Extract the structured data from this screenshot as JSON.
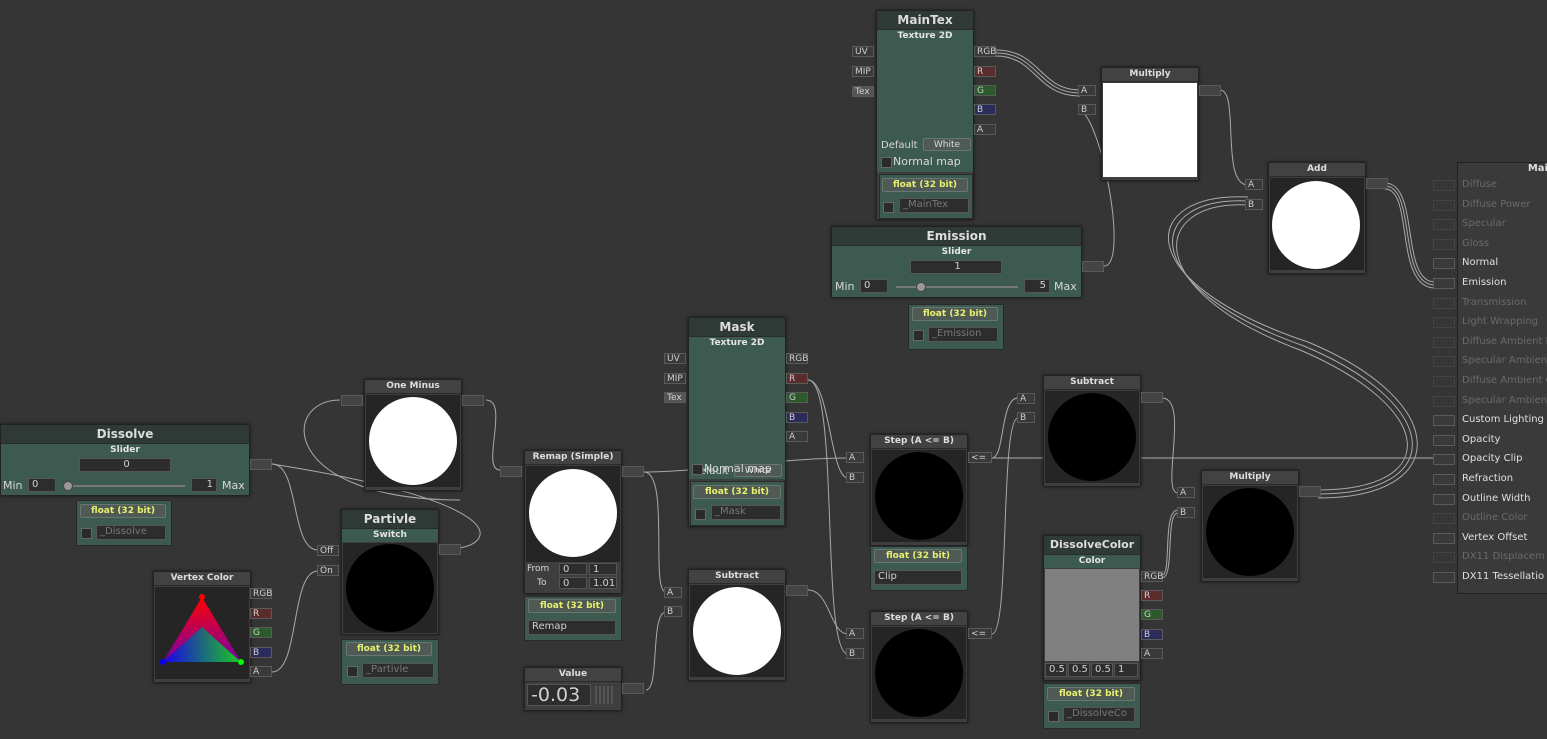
{
  "nodes": {
    "maintex": {
      "title": "MainTex",
      "subtitle": "Texture 2D",
      "inputs": [
        "UV",
        "MIP",
        "Tex"
      ],
      "outputs": [
        "RGB",
        "R",
        "G",
        "B",
        "A"
      ],
      "default_label": "Default",
      "default_value": "White",
      "normal_map": "Normal map",
      "precision": "float (32 bit)",
      "property": "_MainTex"
    },
    "multiply_top": {
      "title": "Multiply",
      "inputs": [
        "A",
        "B"
      ]
    },
    "add": {
      "title": "Add",
      "inputs": [
        "A",
        "B"
      ]
    },
    "emission": {
      "title": "Emission",
      "subtitle": "Slider",
      "value": "1",
      "min_label": "Min",
      "min": "0",
      "max": "5",
      "max_label": "Max",
      "precision": "float (32 bit)",
      "property": "_Emission"
    },
    "mask": {
      "title": "Mask",
      "subtitle": "Texture 2D",
      "inputs": [
        "UV",
        "MIP",
        "Tex"
      ],
      "outputs": [
        "RGB",
        "R",
        "G",
        "B",
        "A"
      ],
      "default_label": "Default",
      "default_value": "White",
      "normal_map": "Normal map",
      "precision": "float (32 bit)",
      "property": "_Mask"
    },
    "one_minus": {
      "title": "One Minus"
    },
    "dissolve": {
      "title": "Dissolve",
      "subtitle": "Slider",
      "value": "0",
      "min_label": "Min",
      "min": "0",
      "max": "1",
      "max_label": "Max",
      "precision": "float (32 bit)",
      "property": "_Dissolve"
    },
    "partivle": {
      "title": "Partivle",
      "subtitle": "Switch",
      "inputs": [
        "Off",
        "On"
      ],
      "precision": "float (32 bit)",
      "property": "_Partivle"
    },
    "vertex_color": {
      "title": "Vertex Color",
      "outputs": [
        "RGB",
        "R",
        "G",
        "B",
        "A"
      ]
    },
    "remap": {
      "title": "Remap (Simple)",
      "from_label": "From",
      "from_a": "0",
      "from_b": "1",
      "to_label": "To",
      "to_a": "0",
      "to_b": "1.01",
      "precision": "float (32 bit)",
      "name": "Remap"
    },
    "value": {
      "title": "Value",
      "value": "-0.03"
    },
    "subtract_bottom": {
      "title": "Subtract",
      "inputs": [
        "A",
        "B"
      ]
    },
    "step_top": {
      "title": "Step (A <= B)",
      "inputs": [
        "A",
        "B"
      ],
      "output": "<=",
      "precision": "float (32 bit)",
      "name": "Clip"
    },
    "step_bottom": {
      "title": "Step (A <= B)",
      "inputs": [
        "A",
        "B"
      ],
      "output": "<="
    },
    "subtract_top": {
      "title": "Subtract",
      "inputs": [
        "A",
        "B"
      ]
    },
    "multiply_bottom": {
      "title": "Multiply",
      "inputs": [
        "A",
        "B"
      ]
    },
    "dissolve_color": {
      "title": "DissolveColor",
      "subtitle": "Color",
      "values": [
        "0.5",
        "0.5",
        "0.5",
        "1"
      ],
      "outputs": [
        "RGB",
        "R",
        "G",
        "B",
        "A"
      ],
      "precision": "float (32 bit)",
      "property": "_DissolveCo"
    }
  },
  "main": {
    "title": "Mai",
    "items": [
      {
        "label": "Diffuse",
        "active": false
      },
      {
        "label": "Diffuse Power",
        "active": false
      },
      {
        "label": "Specular",
        "active": false
      },
      {
        "label": "Gloss",
        "active": false
      },
      {
        "label": "Normal",
        "active": true
      },
      {
        "label": "Emission",
        "active": true
      },
      {
        "label": "Transmission",
        "active": false
      },
      {
        "label": "Light Wrapping",
        "active": false
      },
      {
        "label": "Diffuse Ambient L",
        "active": false
      },
      {
        "label": "Specular Ambien",
        "active": false
      },
      {
        "label": "Diffuse Ambient O",
        "active": false
      },
      {
        "label": "Specular Ambien",
        "active": false
      },
      {
        "label": "Custom Lighting",
        "active": true
      },
      {
        "label": "Opacity",
        "active": true
      },
      {
        "label": "Opacity Clip",
        "active": true
      },
      {
        "label": "Refraction",
        "active": true
      },
      {
        "label": "Outline Width",
        "active": true
      },
      {
        "label": "Outline Color",
        "active": false
      },
      {
        "label": "Vertex Offset",
        "active": true
      },
      {
        "label": "DX11 Displacem",
        "active": false
      },
      {
        "label": "DX11 Tessellatio",
        "active": true
      }
    ]
  },
  "colors": {
    "canvas": "#353535",
    "node_green": "#3d5a50",
    "precision_text": "#e8f070",
    "wire": "#bdbdbd"
  }
}
